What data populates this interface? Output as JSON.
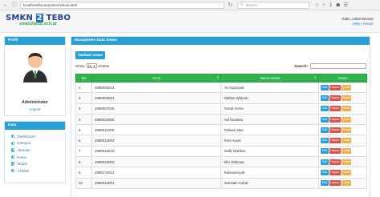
{
  "browser": {
    "url": "localhost/binaurystem/siswa.html",
    "search_placeholder": "Search"
  },
  "header": {
    "logo_text": "SMKN",
    "logo_number": "2",
    "logo_suffix": "TEBO",
    "logo_sub": "smkn2tebo.sch.id",
    "greeting": "Hallo, Administrator",
    "links": "Help | Keluar"
  },
  "profile": {
    "title": "Profil",
    "name": "Administrator",
    "logout": "Logout"
  },
  "data_menu": {
    "title": "Data",
    "items": [
      {
        "label": "Dashboard"
      },
      {
        "label": "Kategori"
      },
      {
        "label": "Jurusan"
      },
      {
        "label": "Kelas"
      },
      {
        "label": "Mapel"
      },
      {
        "label": "ADMIN"
      }
    ]
  },
  "main": {
    "title": "Manajemen Data Siswa",
    "add_button": "Tambah siswa",
    "show_label": "Show",
    "show_value": "10",
    "entries_label": "entries",
    "search_label": "Search:",
    "columns": {
      "no": "No",
      "nis": "N.I.S",
      "nama": "Nama Siswa",
      "action": "Action"
    },
    "actions": {
      "edit": "Edit",
      "delete": "Hapus",
      "detail": "Detail"
    },
    "rows": [
      {
        "no": "1",
        "nis": "1990006214",
        "nama": "Ari Supriyadi"
      },
      {
        "no": "2",
        "nis": "1990003004",
        "nama": "Dahlan Widodo"
      },
      {
        "no": "3",
        "nis": "1990007028",
        "nama": "Faizal Arima"
      },
      {
        "no": "4",
        "nis": "1990010006",
        "nama": "Adi Susanto"
      },
      {
        "no": "5",
        "nis": "1990011009",
        "nama": "Ridwan Mas"
      },
      {
        "no": "6",
        "nis": "1990012003",
        "nama": "Reni Ayuni"
      },
      {
        "no": "7",
        "nis": "1990012019",
        "nama": "Salih Mukhtar"
      },
      {
        "no": "8",
        "nis": "1990010003",
        "nama": "Eko Rahman"
      },
      {
        "no": "9",
        "nis": "1990172012",
        "nama": "Rahmansyah"
      },
      {
        "no": "10",
        "nis": "1990012001",
        "nama": "Samsah Ambar"
      }
    ]
  }
}
